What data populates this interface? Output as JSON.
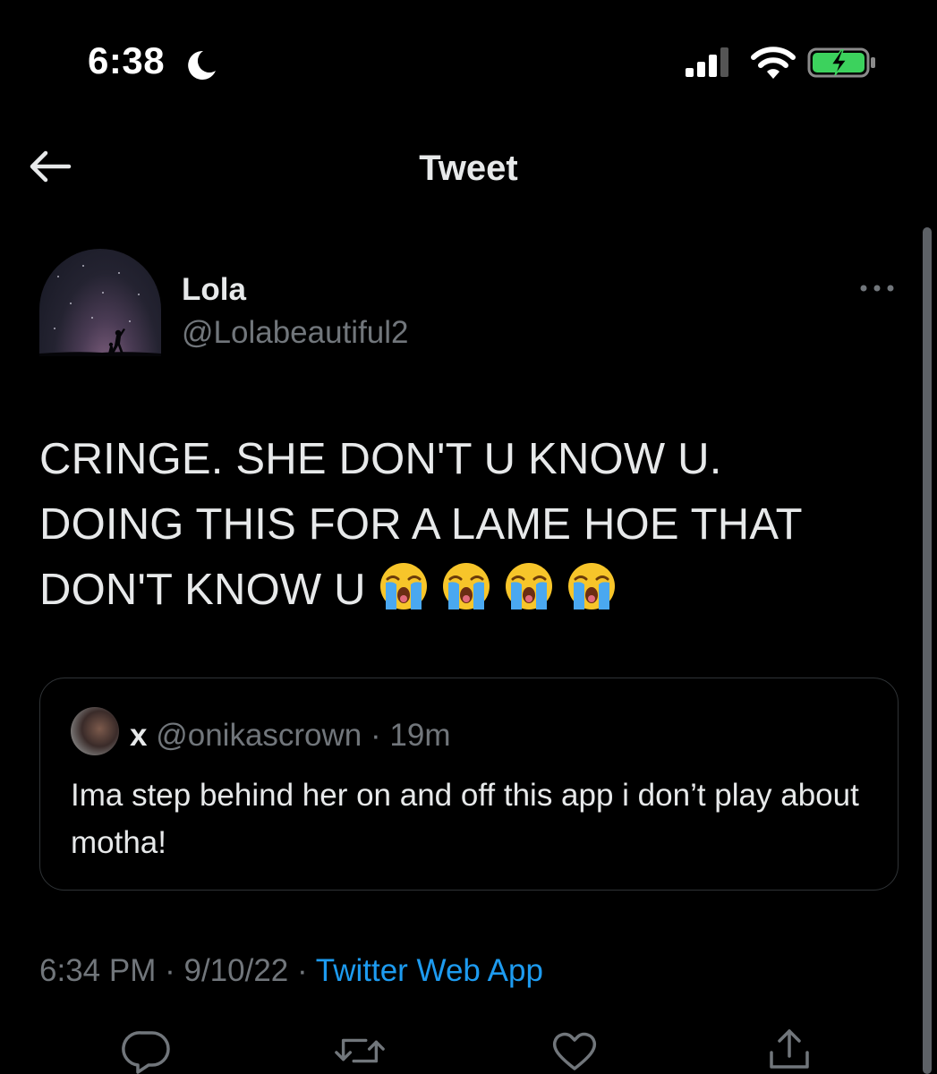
{
  "status_bar": {
    "time": "6:38",
    "icons": [
      "moon-icon",
      "signal-icon",
      "wifi-icon",
      "battery-charging-icon"
    ],
    "battery_color": "#3cd25d"
  },
  "header": {
    "title": "Tweet",
    "back_icon": "arrow-left-icon"
  },
  "tweet": {
    "author": {
      "name": "Lola",
      "handle": "@Lolabeautiful2"
    },
    "text_lines": [
      "CRINGE. SHE DON'T U KNOW U.",
      "DOING THIS FOR A LAME HOE THAT",
      "DON'T KNOW U"
    ],
    "emojis": [
      "loudly-crying-face",
      "loudly-crying-face",
      "loudly-crying-face",
      "loudly-crying-face"
    ],
    "time": "6:34 PM",
    "date": "9/10/22",
    "separator": "·",
    "source": "Twitter Web App"
  },
  "quote": {
    "name": "x",
    "handle": "@onikascrown",
    "separator": "·",
    "age": "19m",
    "text": "Ima step behind her on and off this app i don’t play about motha!"
  },
  "actions": [
    "reply-icon",
    "retweet-icon",
    "like-icon",
    "share-icon"
  ],
  "colors": {
    "background": "#000000",
    "text_primary": "#e7e9ea",
    "text_secondary": "#71767b",
    "link": "#1d9bf0",
    "border": "#2f3336"
  }
}
